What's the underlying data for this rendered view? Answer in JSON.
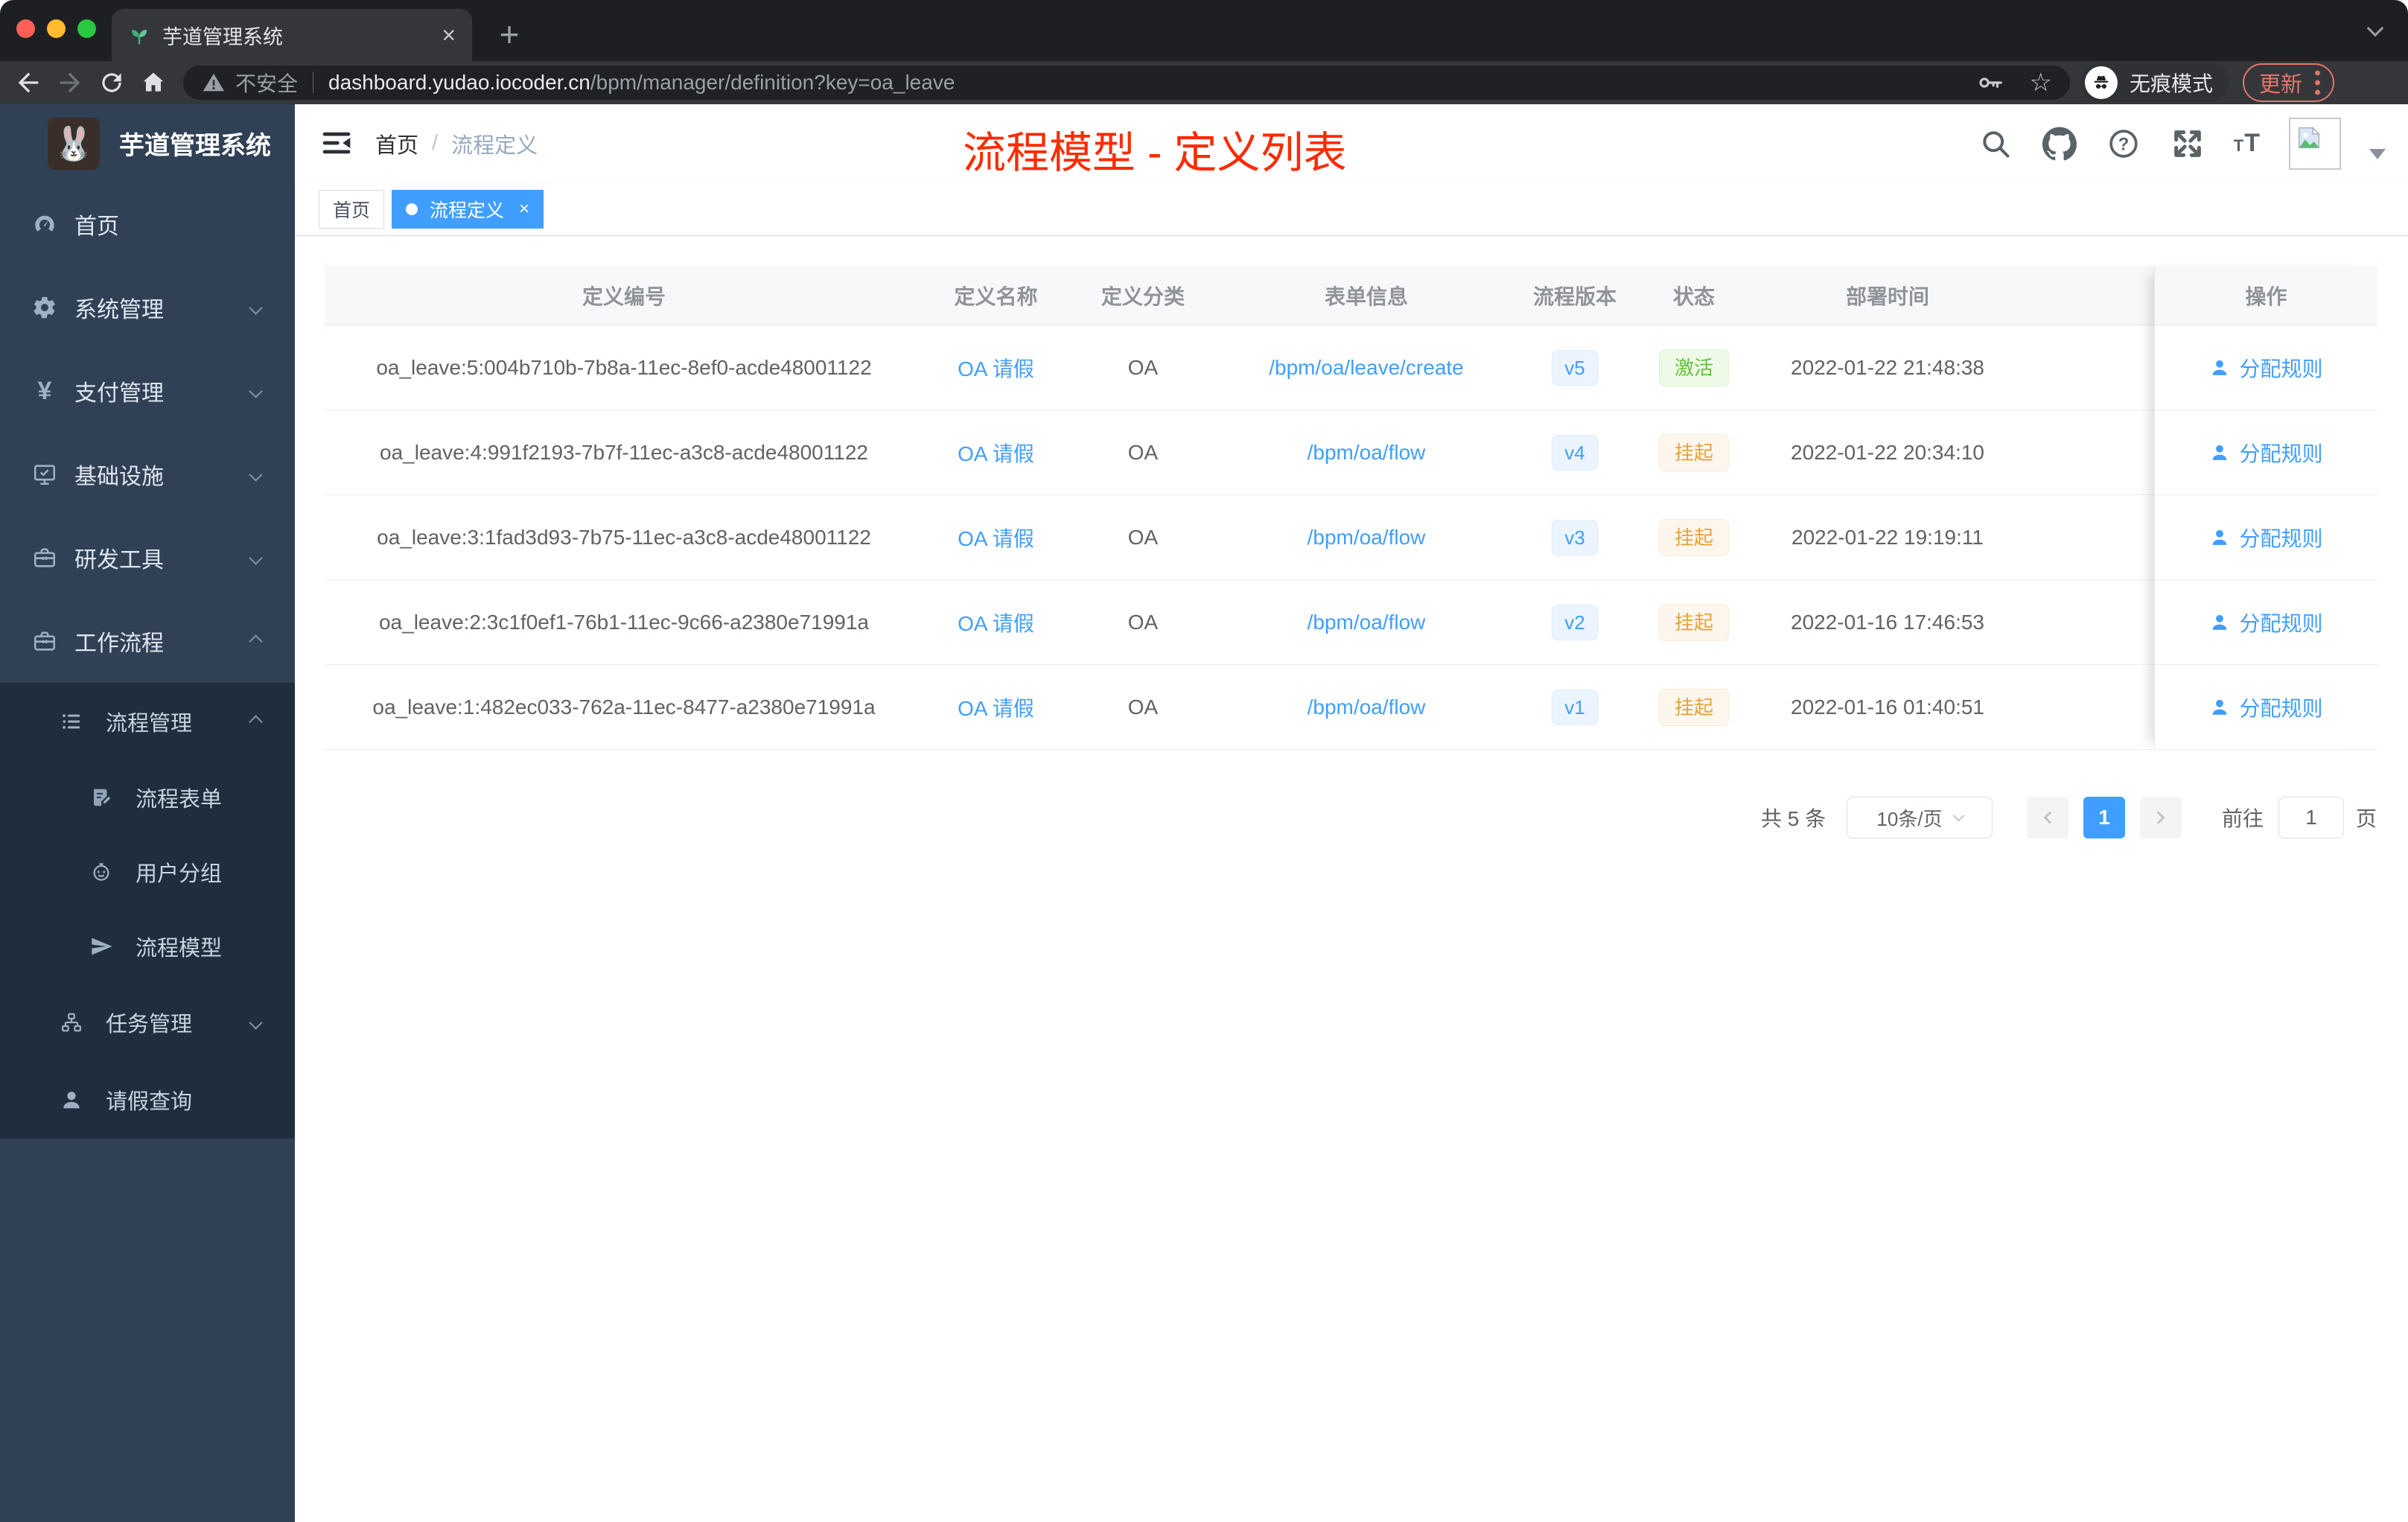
{
  "browser": {
    "tab_title": "芋道管理系统",
    "security_label": "不安全",
    "url_host": "dashboard.yudao.iocoder.cn",
    "url_path": "/bpm/manager/definition?key=oa_leave",
    "incognito_label": "无痕模式",
    "update_label": "更新"
  },
  "sidebar": {
    "logo_title": "芋道管理系统",
    "menu": [
      {
        "label": "首页",
        "icon": "dashboard-icon",
        "level": 1,
        "chevron": ""
      },
      {
        "label": "系统管理",
        "icon": "gear-icon",
        "level": 1,
        "chevron": "down"
      },
      {
        "label": "支付管理",
        "icon": "yen-icon",
        "level": 1,
        "chevron": "down"
      },
      {
        "label": "基础设施",
        "icon": "monitor-icon",
        "level": 1,
        "chevron": "down"
      },
      {
        "label": "研发工具",
        "icon": "toolbox-icon",
        "level": 1,
        "chevron": "down"
      },
      {
        "label": "工作流程",
        "icon": "briefcase-icon",
        "level": 1,
        "chevron": "up"
      },
      {
        "label": "流程管理",
        "icon": "list-tree-icon",
        "level": 2,
        "chevron": "up"
      },
      {
        "label": "流程表单",
        "icon": "form-icon",
        "level": 3,
        "chevron": ""
      },
      {
        "label": "用户分组",
        "icon": "robot-icon",
        "level": 3,
        "chevron": ""
      },
      {
        "label": "流程模型",
        "icon": "paper-plane-icon",
        "level": 3,
        "chevron": ""
      },
      {
        "label": "任务管理",
        "icon": "org-tree-icon",
        "level": 2,
        "chevron": "down"
      },
      {
        "label": "请假查询",
        "icon": "user-icon",
        "level": 2,
        "chevron": ""
      }
    ]
  },
  "header": {
    "breadcrumb": {
      "home": "首页",
      "separator": "/",
      "current": "流程定义"
    },
    "annotation_title": "流程模型 - 定义列表"
  },
  "tags": {
    "items": [
      {
        "label": "首页",
        "active": false
      },
      {
        "label": "流程定义",
        "active": true
      }
    ]
  },
  "table": {
    "columns": [
      "定义编号",
      "定义名称",
      "定义分类",
      "表单信息",
      "流程版本",
      "状态",
      "部署时间",
      "操作"
    ],
    "action_label": "分配规则",
    "rows": [
      {
        "id": "oa_leave:5:004b710b-7b8a-11ec-8ef0-acde48001122",
        "name": "OA 请假",
        "category": "OA",
        "form": "/bpm/oa/leave/create",
        "version": "v5",
        "status": "激活",
        "status_type": "success",
        "deployed_at": "2022-01-22 21:48:38"
      },
      {
        "id": "oa_leave:4:991f2193-7b7f-11ec-a3c8-acde48001122",
        "name": "OA 请假",
        "category": "OA",
        "form": "/bpm/oa/flow",
        "version": "v4",
        "status": "挂起",
        "status_type": "warning",
        "deployed_at": "2022-01-22 20:34:10"
      },
      {
        "id": "oa_leave:3:1fad3d93-7b75-11ec-a3c8-acde48001122",
        "name": "OA 请假",
        "category": "OA",
        "form": "/bpm/oa/flow",
        "version": "v3",
        "status": "挂起",
        "status_type": "warning",
        "deployed_at": "2022-01-22 19:19:11"
      },
      {
        "id": "oa_leave:2:3c1f0ef1-76b1-11ec-9c66-a2380e71991a",
        "name": "OA 请假",
        "category": "OA",
        "form": "/bpm/oa/flow",
        "version": "v2",
        "status": "挂起",
        "status_type": "warning",
        "deployed_at": "2022-01-16 17:46:53"
      },
      {
        "id": "oa_leave:1:482ec033-762a-11ec-8477-a2380e71991a",
        "name": "OA 请假",
        "category": "OA",
        "form": "/bpm/oa/flow",
        "version": "v1",
        "status": "挂起",
        "status_type": "warning",
        "deployed_at": "2022-01-16 01:40:51"
      }
    ]
  },
  "pagination": {
    "total": "共 5 条",
    "page_size": "10条/页",
    "current_page": "1",
    "goto_label": "前往",
    "goto_value": "1",
    "unit": "页"
  },
  "glyphs": {
    "tab_close": "×",
    "new_tab": "+",
    "tag_close": "×",
    "star": "☆"
  },
  "colors": {
    "accent": "#409eff",
    "success": "#67c23a",
    "warning": "#e6a23c",
    "annotation_red": "#fb2b00",
    "sidebar_bg": "#304156",
    "submenu_bg": "#1f2d3d"
  }
}
